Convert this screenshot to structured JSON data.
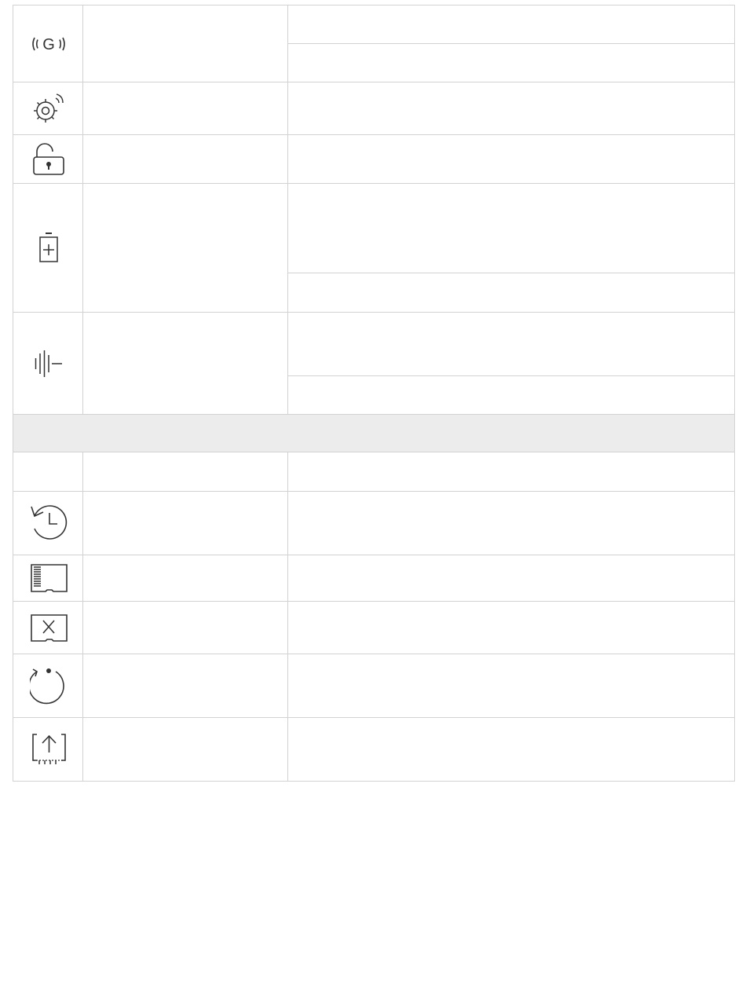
{
  "table": {
    "section_header": "",
    "rows": [
      {
        "icon": "gps-signal-icon",
        "name": "",
        "descriptions": [
          "",
          ""
        ]
      },
      {
        "icon": "gear-wireless-icon",
        "name": "",
        "descriptions": [
          ""
        ]
      },
      {
        "icon": "unlocked-padlock-icon",
        "name": "",
        "descriptions": [
          ""
        ]
      },
      {
        "icon": "battery-charging-icon",
        "name": "",
        "descriptions": [
          "",
          ""
        ]
      },
      {
        "icon": "vibration-icon",
        "name": "",
        "descriptions": [
          "",
          ""
        ]
      },
      {
        "icon": "",
        "name": "",
        "descriptions": [
          ""
        ]
      },
      {
        "icon": "history-clock-icon",
        "name": "",
        "descriptions": [
          ""
        ]
      },
      {
        "icon": "sd-card-icon",
        "name": "",
        "descriptions": [
          ""
        ]
      },
      {
        "icon": "sd-card-error-icon",
        "name": "",
        "descriptions": [
          ""
        ]
      },
      {
        "icon": "restart-icon",
        "name": "",
        "descriptions": [
          ""
        ]
      },
      {
        "icon": "firmware-upload-icon",
        "name": "",
        "descriptions": [
          ""
        ]
      }
    ]
  },
  "colors": {
    "grid_line": "#d2d2d2",
    "section_band": "#ececec",
    "icon_stroke": "#333333"
  }
}
